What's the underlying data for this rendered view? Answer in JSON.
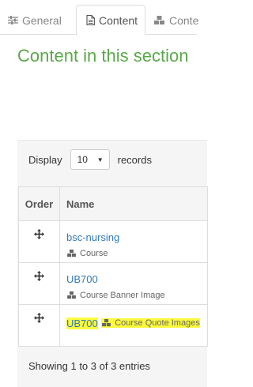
{
  "tabs": [
    {
      "label": "General",
      "icon": "sliders-icon"
    },
    {
      "label": "Content",
      "icon": "document-icon"
    },
    {
      "label": "Conte",
      "icon": "cubes-icon"
    }
  ],
  "section_title": "Content in this section",
  "records_control": {
    "prefix": "Display",
    "selected": "10",
    "suffix": "records"
  },
  "table": {
    "headers": {
      "order": "Order",
      "name": "Name"
    },
    "rows": [
      {
        "name": "bsc-nursing",
        "type": "Course",
        "highlighted": false
      },
      {
        "name": "UB700",
        "type": "Course Banner Image",
        "highlighted": false
      },
      {
        "name": "UB700",
        "type": "Course Quote Images",
        "highlighted": true
      }
    ]
  },
  "footer": {
    "showing": "Showing 1 to 3 of 3 entries"
  },
  "colors": {
    "title": "#5aa84a",
    "link": "#337ab7",
    "highlight": "#fbfb3c"
  }
}
